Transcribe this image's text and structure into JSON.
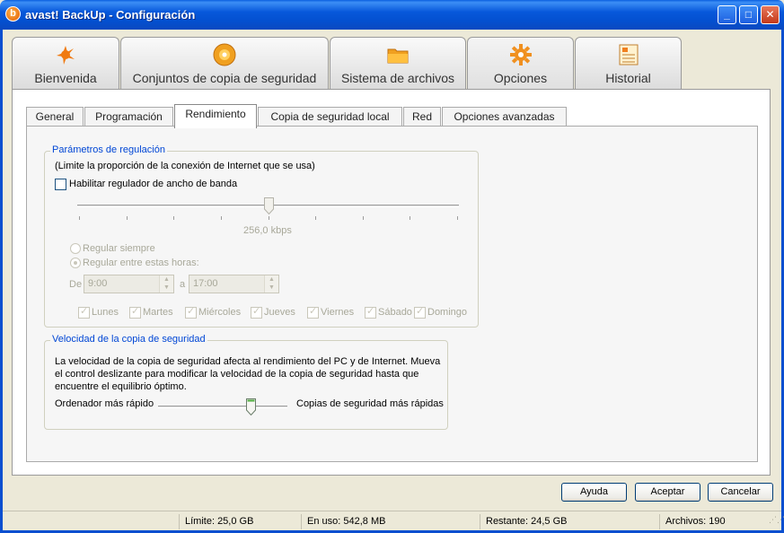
{
  "window": {
    "title": "avast! BackUp - Configuración",
    "icon": "avast-logo-icon"
  },
  "window_controls": [
    "minimize-icon",
    "maximize-icon",
    "close-icon"
  ],
  "main_tabs": [
    {
      "label": "Bienvenida",
      "icon": "avast-star-icon",
      "active": false
    },
    {
      "label": "Conjuntos de copia de seguridad",
      "icon": "disc-icon",
      "active": false
    },
    {
      "label": "Sistema de archivos",
      "icon": "folder-icon",
      "active": false
    },
    {
      "label": "Opciones",
      "icon": "gear-icon",
      "active": true
    },
    {
      "label": "Historial",
      "icon": "history-log-icon",
      "active": false
    }
  ],
  "sub_tabs": [
    {
      "label": "General",
      "active": false
    },
    {
      "label": "Programación",
      "active": false
    },
    {
      "label": "Rendimiento",
      "active": true
    },
    {
      "label": "Copia de seguridad local",
      "active": false
    },
    {
      "label": "Red",
      "active": false
    },
    {
      "label": "Opciones avanzadas",
      "active": false
    }
  ],
  "throttle": {
    "group_title": "Parámetros de regulación",
    "description": "(Limite la proporción de la conexión de Internet que se usa)",
    "enable_label": "Habilitar regulador de ancho de banda",
    "enabled": false,
    "bandwidth_value": "256,0 kbps",
    "bandwidth_fraction": 0.5,
    "radio_always": "Regular siempre",
    "radio_between": "Regular entre estas horas:",
    "from_label": "De",
    "from_time": "9:00",
    "to_label": "a",
    "to_time": "17:00",
    "days": [
      "Lunes",
      "Martes",
      "Miércoles",
      "Jueves",
      "Viernes",
      "Sábado",
      "Domingo"
    ]
  },
  "speed": {
    "group_title": "Velocidad de la copia de seguridad",
    "description_line1": "La velocidad de la copia de seguridad afecta al rendimiento del PC y de Internet. Mueva",
    "description_line2": "el control deslizante para modificar la velocidad de la copia de seguridad hasta que",
    "description_line3": "encuentre el equilibrio óptimo.",
    "left_label": "Ordenador más rápido",
    "right_label": "Copias de seguridad más rápidas",
    "slider_fraction": 0.72
  },
  "buttons": {
    "help": "Ayuda",
    "accept": "Aceptar",
    "cancel": "Cancelar"
  },
  "status": {
    "limit": "Límite: 25,0 GB",
    "in_use": "En uso: 542,8 MB",
    "remaining": "Restante: 24,5 GB",
    "files": "Archivos: 190"
  }
}
